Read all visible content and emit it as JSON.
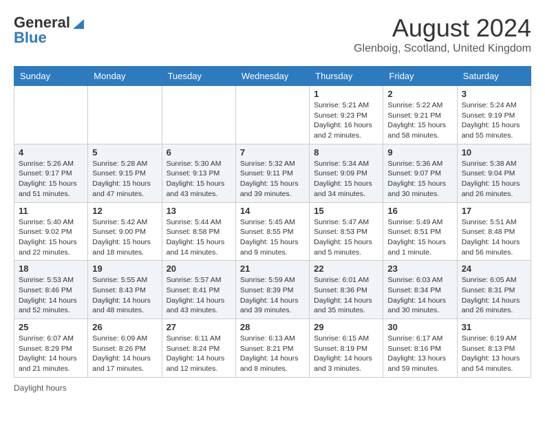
{
  "header": {
    "logo_general": "General",
    "logo_blue": "Blue",
    "title": "August 2024",
    "subtitle": "Glenboig, Scotland, United Kingdom"
  },
  "calendar": {
    "days_of_week": [
      "Sunday",
      "Monday",
      "Tuesday",
      "Wednesday",
      "Thursday",
      "Friday",
      "Saturday"
    ],
    "weeks": [
      [
        {
          "day": "",
          "info": ""
        },
        {
          "day": "",
          "info": ""
        },
        {
          "day": "",
          "info": ""
        },
        {
          "day": "",
          "info": ""
        },
        {
          "day": "1",
          "info": "Sunrise: 5:21 AM\nSunset: 9:23 PM\nDaylight: 16 hours\nand 2 minutes."
        },
        {
          "day": "2",
          "info": "Sunrise: 5:22 AM\nSunset: 9:21 PM\nDaylight: 15 hours\nand 58 minutes."
        },
        {
          "day": "3",
          "info": "Sunrise: 5:24 AM\nSunset: 9:19 PM\nDaylight: 15 hours\nand 55 minutes."
        }
      ],
      [
        {
          "day": "4",
          "info": "Sunrise: 5:26 AM\nSunset: 9:17 PM\nDaylight: 15 hours\nand 51 minutes."
        },
        {
          "day": "5",
          "info": "Sunrise: 5:28 AM\nSunset: 9:15 PM\nDaylight: 15 hours\nand 47 minutes."
        },
        {
          "day": "6",
          "info": "Sunrise: 5:30 AM\nSunset: 9:13 PM\nDaylight: 15 hours\nand 43 minutes."
        },
        {
          "day": "7",
          "info": "Sunrise: 5:32 AM\nSunset: 9:11 PM\nDaylight: 15 hours\nand 39 minutes."
        },
        {
          "day": "8",
          "info": "Sunrise: 5:34 AM\nSunset: 9:09 PM\nDaylight: 15 hours\nand 34 minutes."
        },
        {
          "day": "9",
          "info": "Sunrise: 5:36 AM\nSunset: 9:07 PM\nDaylight: 15 hours\nand 30 minutes."
        },
        {
          "day": "10",
          "info": "Sunrise: 5:38 AM\nSunset: 9:04 PM\nDaylight: 15 hours\nand 26 minutes."
        }
      ],
      [
        {
          "day": "11",
          "info": "Sunrise: 5:40 AM\nSunset: 9:02 PM\nDaylight: 15 hours\nand 22 minutes."
        },
        {
          "day": "12",
          "info": "Sunrise: 5:42 AM\nSunset: 9:00 PM\nDaylight: 15 hours\nand 18 minutes."
        },
        {
          "day": "13",
          "info": "Sunrise: 5:44 AM\nSunset: 8:58 PM\nDaylight: 15 hours\nand 14 minutes."
        },
        {
          "day": "14",
          "info": "Sunrise: 5:45 AM\nSunset: 8:55 PM\nDaylight: 15 hours\nand 9 minutes."
        },
        {
          "day": "15",
          "info": "Sunrise: 5:47 AM\nSunset: 8:53 PM\nDaylight: 15 hours\nand 5 minutes."
        },
        {
          "day": "16",
          "info": "Sunrise: 5:49 AM\nSunset: 8:51 PM\nDaylight: 15 hours\nand 1 minute."
        },
        {
          "day": "17",
          "info": "Sunrise: 5:51 AM\nSunset: 8:48 PM\nDaylight: 14 hours\nand 56 minutes."
        }
      ],
      [
        {
          "day": "18",
          "info": "Sunrise: 5:53 AM\nSunset: 8:46 PM\nDaylight: 14 hours\nand 52 minutes."
        },
        {
          "day": "19",
          "info": "Sunrise: 5:55 AM\nSunset: 8:43 PM\nDaylight: 14 hours\nand 48 minutes."
        },
        {
          "day": "20",
          "info": "Sunrise: 5:57 AM\nSunset: 8:41 PM\nDaylight: 14 hours\nand 43 minutes."
        },
        {
          "day": "21",
          "info": "Sunrise: 5:59 AM\nSunset: 8:39 PM\nDaylight: 14 hours\nand 39 minutes."
        },
        {
          "day": "22",
          "info": "Sunrise: 6:01 AM\nSunset: 8:36 PM\nDaylight: 14 hours\nand 35 minutes."
        },
        {
          "day": "23",
          "info": "Sunrise: 6:03 AM\nSunset: 8:34 PM\nDaylight: 14 hours\nand 30 minutes."
        },
        {
          "day": "24",
          "info": "Sunrise: 6:05 AM\nSunset: 8:31 PM\nDaylight: 14 hours\nand 26 minutes."
        }
      ],
      [
        {
          "day": "25",
          "info": "Sunrise: 6:07 AM\nSunset: 8:29 PM\nDaylight: 14 hours\nand 21 minutes."
        },
        {
          "day": "26",
          "info": "Sunrise: 6:09 AM\nSunset: 8:26 PM\nDaylight: 14 hours\nand 17 minutes."
        },
        {
          "day": "27",
          "info": "Sunrise: 6:11 AM\nSunset: 8:24 PM\nDaylight: 14 hours\nand 12 minutes."
        },
        {
          "day": "28",
          "info": "Sunrise: 6:13 AM\nSunset: 8:21 PM\nDaylight: 14 hours\nand 8 minutes."
        },
        {
          "day": "29",
          "info": "Sunrise: 6:15 AM\nSunset: 8:19 PM\nDaylight: 14 hours\nand 3 minutes."
        },
        {
          "day": "30",
          "info": "Sunrise: 6:17 AM\nSunset: 8:16 PM\nDaylight: 13 hours\nand 59 minutes."
        },
        {
          "day": "31",
          "info": "Sunrise: 6:19 AM\nSunset: 8:13 PM\nDaylight: 13 hours\nand 54 minutes."
        }
      ]
    ]
  },
  "footer": {
    "note": "Daylight hours"
  }
}
